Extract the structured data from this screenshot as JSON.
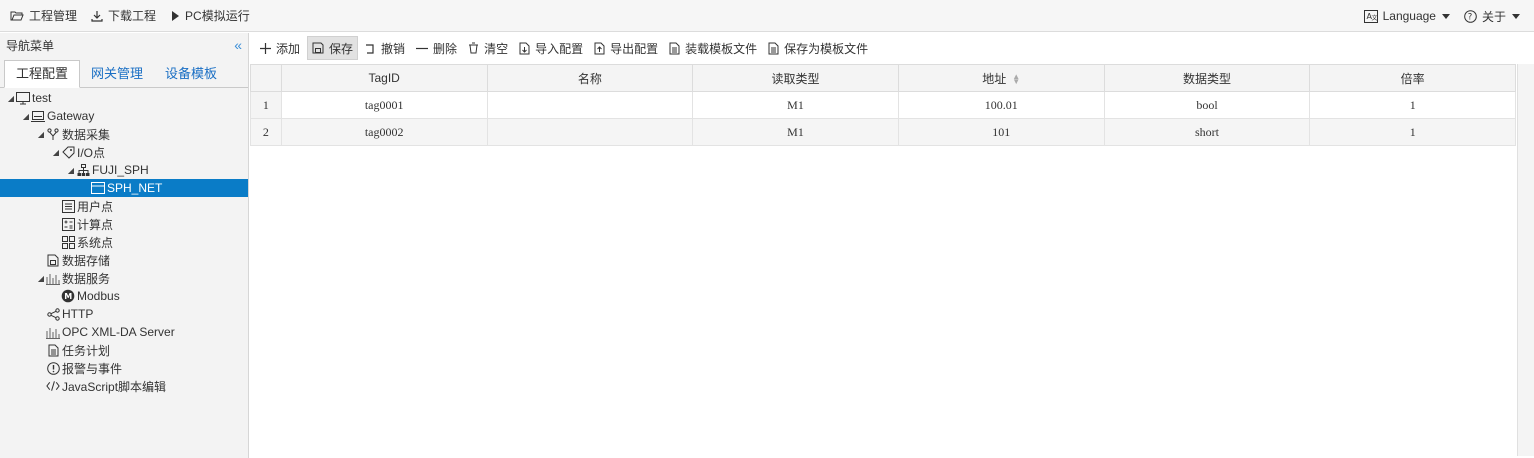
{
  "topbar": {
    "project": "工程管理",
    "download": "下载工程",
    "simulate": "PC模拟运行",
    "language": "Language",
    "about": "关于"
  },
  "sidebar": {
    "title": "导航菜单",
    "tabs": [
      "工程配置",
      "网关管理",
      "设备模板"
    ],
    "tree": [
      {
        "label": "test",
        "level": 0,
        "expand": "open",
        "icon": "monitor-icon"
      },
      {
        "label": "Gateway",
        "level": 1,
        "expand": "open",
        "icon": "gateway-icon"
      },
      {
        "label": "数据采集",
        "level": 2,
        "expand": "open",
        "icon": "fork-icon"
      },
      {
        "label": "I/O点",
        "level": 3,
        "expand": "open",
        "icon": "tag-icon"
      },
      {
        "label": "FUJI_SPH",
        "level": 4,
        "expand": "open",
        "icon": "network-icon"
      },
      {
        "label": "SPH_NET",
        "level": 5,
        "expand": "none",
        "icon": "card-icon",
        "selected": true
      },
      {
        "label": "用户点",
        "level": 3,
        "expand": "none",
        "icon": "list-icon"
      },
      {
        "label": "计算点",
        "level": 3,
        "expand": "none",
        "icon": "calc-icon"
      },
      {
        "label": "系统点",
        "level": 3,
        "expand": "none",
        "icon": "grid-icon"
      },
      {
        "label": "数据存储",
        "level": 2,
        "expand": "none",
        "icon": "storage-icon"
      },
      {
        "label": "数据服务",
        "level": 2,
        "expand": "open",
        "icon": "chart-icon"
      },
      {
        "label": "Modbus",
        "level": 3,
        "expand": "none",
        "icon": "modbus-icon"
      },
      {
        "label": "HTTP",
        "level": 2,
        "expand": "none",
        "icon": "share-icon"
      },
      {
        "label": "OPC XML-DA Server",
        "level": 2,
        "expand": "none",
        "icon": "chart-icon"
      },
      {
        "label": "任务计划",
        "level": 2,
        "expand": "none",
        "icon": "doc-icon"
      },
      {
        "label": "报警与事件",
        "level": 2,
        "expand": "none",
        "icon": "alert-icon"
      },
      {
        "label": "JavaScript脚本编辑",
        "level": 2,
        "expand": "none",
        "icon": "code-icon"
      }
    ]
  },
  "toolbar": {
    "add": "添加",
    "save": "保存",
    "undo": "撤销",
    "delete": "删除",
    "clear": "清空",
    "import": "导入配置",
    "export": "导出配置",
    "load_template": "装载模板文件",
    "save_template": "保存为模板文件"
  },
  "table": {
    "columns": [
      "TagID",
      "名称",
      "读取类型",
      "地址",
      "数据类型",
      "倍率"
    ],
    "rows": [
      {
        "n": "1",
        "tagid": "tag0001",
        "name": "",
        "read": "M1",
        "addr": "100.01",
        "dtype": "bool",
        "rate": "1"
      },
      {
        "n": "2",
        "tagid": "tag0002",
        "name": "",
        "read": "M1",
        "addr": "101",
        "dtype": "short",
        "rate": "1"
      }
    ]
  }
}
